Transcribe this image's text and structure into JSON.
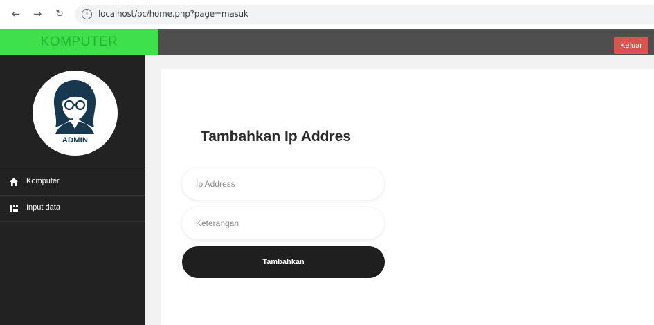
{
  "browser": {
    "back_icon": "arrow-left",
    "forward_icon": "arrow-right",
    "reload_icon": "reload",
    "url": "localhost/pc/home.php?page=masuk"
  },
  "header": {
    "brand": "KOMPUTER",
    "logout_label": "Keluar",
    "brand_color": "#3ee04c",
    "logout_color": "#d9534f"
  },
  "sidebar": {
    "avatar_label": "ADMIN",
    "items": [
      {
        "label": "Komputer",
        "icon": "home-icon"
      },
      {
        "label": "Input data",
        "icon": "input-data-icon"
      }
    ]
  },
  "form": {
    "title": "Tambahkan Ip Addres",
    "ip_placeholder": "Ip Address",
    "ip_value": "",
    "note_placeholder": "Keterangan",
    "note_value": "",
    "submit_label": "Tambahkan"
  }
}
